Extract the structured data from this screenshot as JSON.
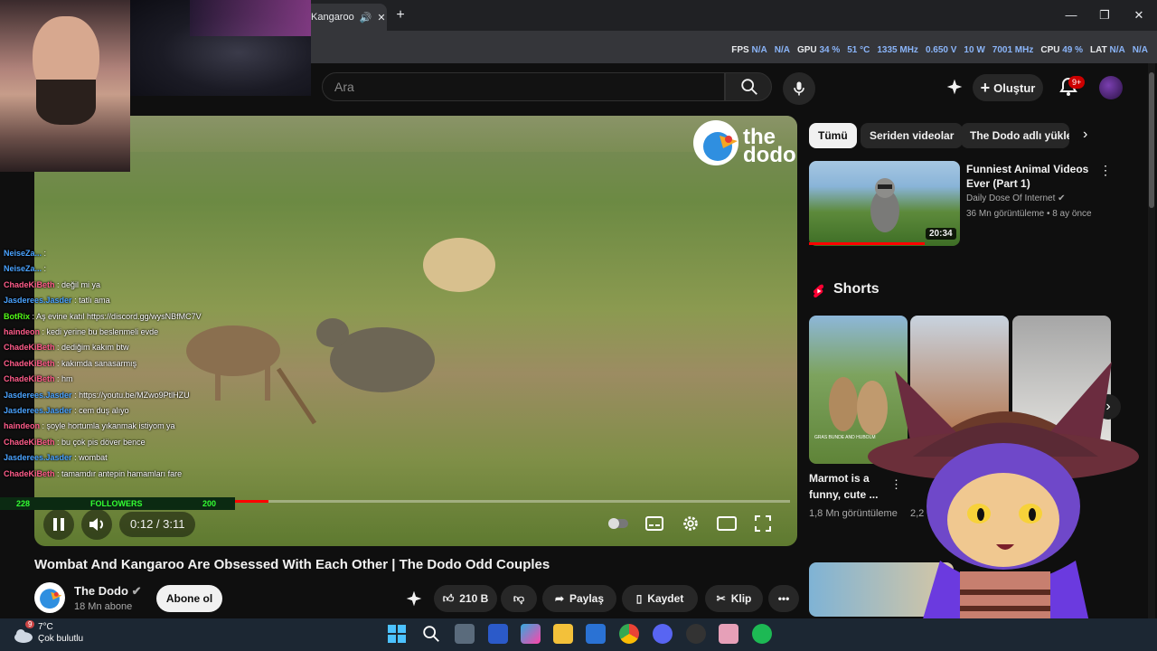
{
  "browser": {
    "tab_title": "Kangaroo",
    "stats": [
      {
        "k": "FPS",
        "v": "N/A"
      },
      {
        "k": "",
        "v": "N/A"
      },
      {
        "k": "GPU",
        "v": "34 %"
      },
      {
        "k": "",
        "v": "51 °C"
      },
      {
        "k": "",
        "v": "1335 MHz"
      },
      {
        "k": "",
        "v": "0.650 V"
      },
      {
        "k": "",
        "v": "10 W"
      },
      {
        "k": "",
        "v": "7001 MHz"
      },
      {
        "k": "CPU",
        "v": "49 %"
      },
      {
        "k": "LAT",
        "v": "N/A"
      },
      {
        "k": "",
        "v": "N/A"
      }
    ]
  },
  "header": {
    "search_placeholder": "Ara",
    "create_label": "Oluştur",
    "notif_count": "9+"
  },
  "video": {
    "watermark": "the dodo",
    "time": "0:12 / 3:11",
    "progress": 0.063,
    "title": "Wombat And Kangaroo Are Obsessed With Each Other | The Dodo Odd Couples"
  },
  "channel": {
    "name": "The Dodo",
    "subscribers": "18 Mn abone",
    "subscribe_label": "Abone ol"
  },
  "actions": {
    "likes": "210 B",
    "share": "Paylaş",
    "save": "Kaydet",
    "clip": "Klip"
  },
  "chat": [
    {
      "user": "NeiseZa...",
      "msg": ":",
      "color": "#4aa3ff"
    },
    {
      "user": "NeiseZa...",
      "msg": ":",
      "color": "#4aa3ff"
    },
    {
      "user": "ChadeKiBeth",
      "msg": ": değil mi ya",
      "color": "#ff5c8a"
    },
    {
      "user": "Jasderees.Jasder",
      "msg": ": tatlı ama",
      "color": "#4aa3ff"
    },
    {
      "user": "BotRix",
      "msg": ": Aş evine katıl https://discord.gg/wysNBfMC7V",
      "color": "#53fc18"
    },
    {
      "user": "haindeon",
      "msg": ": kedi yerine bu beslenmeli evde",
      "color": "#ff5c8a"
    },
    {
      "user": "ChadeKiBeth",
      "msg": ": dediğim kakım btw",
      "color": "#ff5c8a"
    },
    {
      "user": "ChadeKiBeth",
      "msg": ": kakımda sanasarmış",
      "color": "#ff5c8a"
    },
    {
      "user": "ChadeKiBeth",
      "msg": ": hm",
      "color": "#ff5c8a"
    },
    {
      "user": "Jasderees.Jasder",
      "msg": ": https://youtu.be/MZwo9PtlHZU",
      "color": "#4aa3ff"
    },
    {
      "user": "Jasderees.Jasder",
      "msg": ": cem duş alıyo",
      "color": "#4aa3ff"
    },
    {
      "user": "haindeon",
      "msg": ": şoyle hortumla yıkanmak istiyom ya",
      "color": "#ff5c8a"
    },
    {
      "user": "ChadeKiBeth",
      "msg": ": bu çok pis döver bence",
      "color": "#ff5c8a"
    },
    {
      "user": "Jasderees.Jasder",
      "msg": ": wombat",
      "color": "#4aa3ff"
    },
    {
      "user": "ChadeKiBeth",
      "msg": ": tamamdır antepin hamamları fare",
      "color": "#ff5c8a"
    }
  ],
  "followers": {
    "left": "228",
    "label": "FOLLOWERS",
    "right": "200"
  },
  "chips": [
    "Tümü",
    "Seriden videolar",
    "The Dodo adlı yükleyici"
  ],
  "recommended": {
    "title": "Funniest Animal Videos Ever (Part 1)",
    "channel": "Daily Dose Of Internet",
    "meta": "36 Mn görüntüleme • 8 ay önce",
    "duration": "20:34"
  },
  "shorts": {
    "heading": "Shorts",
    "items": [
      {
        "title": "Marmot is a funny, cute ...",
        "views": "1,8 Mn görüntüleme",
        "overlay": "GRAS BUNDE AND HUBOLM"
      },
      {
        "title": "...",
        "views": "2,2 Mn görüntüleme"
      }
    ]
  },
  "weather": {
    "temp": "7°C",
    "cond": "Çok bulutlu",
    "badge": "9"
  },
  "colors": {
    "accent": "#ff0000",
    "chip_active": "#f1f1f1",
    "bg": "#0f0f0f"
  }
}
